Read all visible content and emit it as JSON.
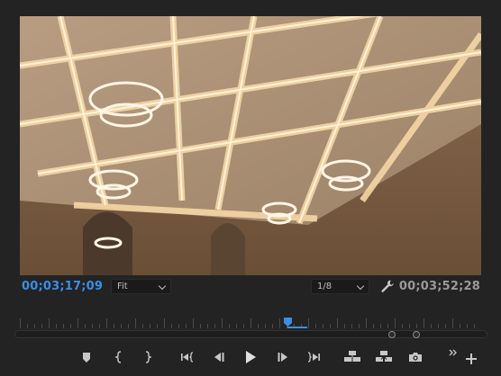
{
  "timecode": {
    "current": "00;03;17;09",
    "duration": "00;03;52;28"
  },
  "zoom_select": {
    "value": "Fit"
  },
  "resolution_select": {
    "value": "1/8"
  },
  "playhead_position": 0.58,
  "colors": {
    "accent": "#3a8ee6",
    "panel_bg": "#232323",
    "icon": "#c8c8c8"
  },
  "icons": {
    "settings": "wrench-icon",
    "marker": "marker-icon",
    "mark_in": "mark-in-icon",
    "mark_out": "mark-out-icon",
    "go_to_in": "go-to-in-icon",
    "step_back": "step-back-icon",
    "play": "play-icon",
    "step_forward": "step-forward-icon",
    "go_to_out": "go-to-out-icon",
    "lift": "lift-icon",
    "extract": "extract-icon",
    "export_frame": "camera-icon",
    "more": "double-chevron-icon",
    "add": "plus-icon"
  }
}
